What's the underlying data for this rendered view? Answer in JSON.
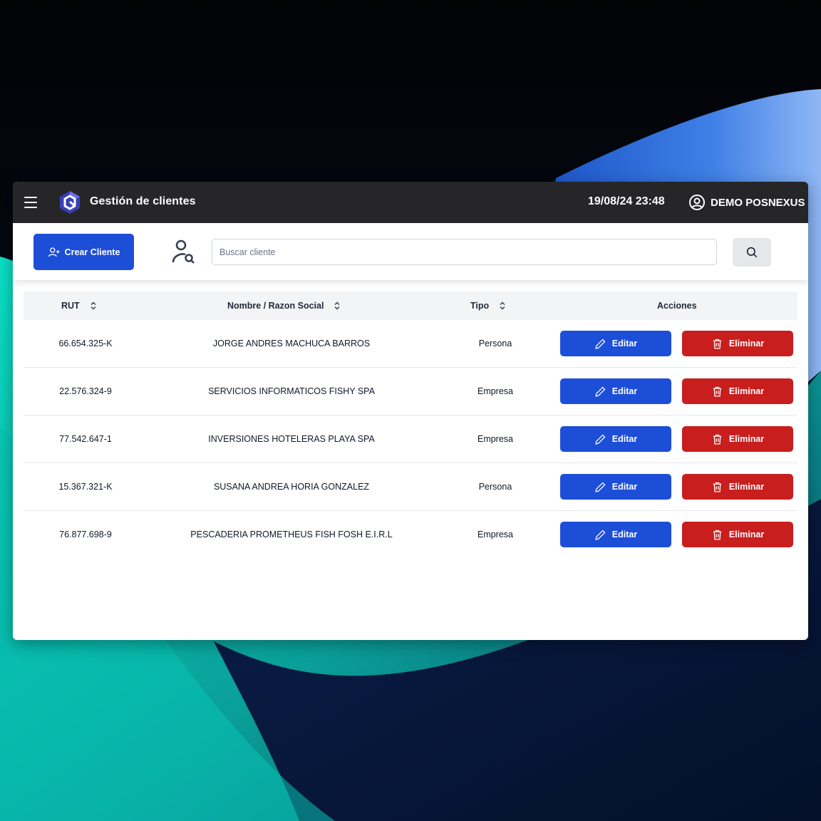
{
  "colors": {
    "topbar": "#262628",
    "primary": "#1d4ed8",
    "danger": "#c81e1e",
    "header_bg": "#f3f4f6"
  },
  "header": {
    "menu_icon": "hamburger-icon",
    "logo_icon": "posnexus-logo",
    "title": "Gestión de clientes",
    "datetime": "19/08/24 23:48",
    "user_icon": "user-circle-icon",
    "user_name": "DEMO POSNEXUS"
  },
  "toolbar": {
    "create_label": "Crear Cliente",
    "create_icon": "user-plus-icon",
    "search_user_icon": "user-search-icon",
    "search_placeholder": "Buscar cliente",
    "search_value": "",
    "search_button_icon": "search-icon"
  },
  "table": {
    "columns": {
      "rut": "RUT",
      "nombre": "Nombre / Razon Social",
      "tipo": "Tipo",
      "acciones": "Acciones"
    },
    "rows": [
      {
        "rut": "66.654.325-K",
        "nombre": "JORGE ANDRES MACHUCA BARROS",
        "tipo": "Persona"
      },
      {
        "rut": "22.576.324-9",
        "nombre": "SERVICIOS INFORMATICOS FISHY SPA",
        "tipo": "Empresa"
      },
      {
        "rut": "77.542.647-1",
        "nombre": "INVERSIONES HOTELERAS PLAYA SPA",
        "tipo": "Empresa"
      },
      {
        "rut": "15.367.321-K",
        "nombre": "SUSANA ANDREA HORIA GONZALEZ",
        "tipo": "Persona"
      },
      {
        "rut": "76.877.698-9",
        "nombre": "PESCADERIA PROMETHEUS FISH FOSH E.I.R.L",
        "tipo": "Empresa"
      }
    ],
    "edit_label": "Editar",
    "delete_label": "Eliminar"
  }
}
